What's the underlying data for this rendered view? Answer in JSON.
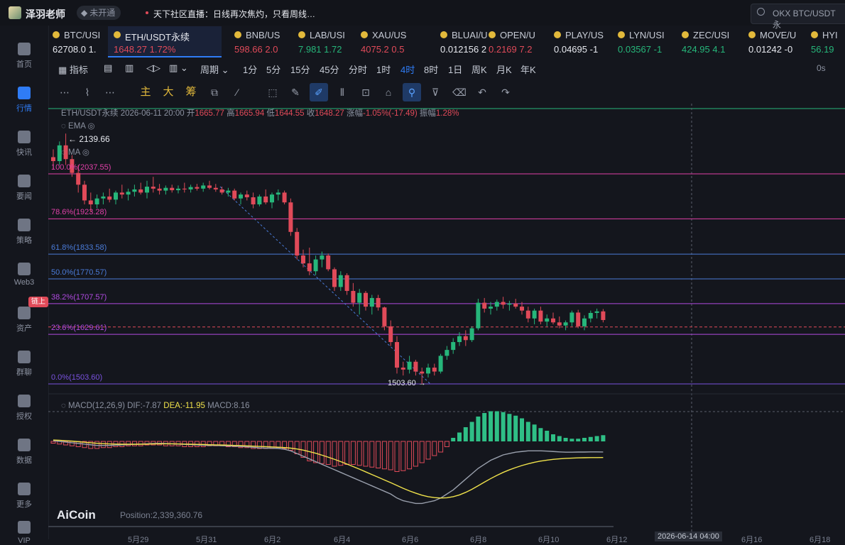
{
  "header": {
    "username": "泽羽老师",
    "vip_label": "未开通",
    "live_text": "天下社区直播：日线再次焦灼，只看周线…",
    "search_text": "OKX BTC/USDT 永"
  },
  "sidebar": {
    "items": [
      {
        "label": "首页",
        "icon": "home-icon"
      },
      {
        "label": "行情",
        "icon": "market-icon",
        "active": true
      },
      {
        "label": "快讯",
        "icon": "news-icon"
      },
      {
        "label": "要闻",
        "icon": "headline-icon"
      },
      {
        "label": "策略",
        "icon": "strategy-icon"
      },
      {
        "label": "Web3",
        "icon": "web3-icon"
      },
      {
        "label": "资产",
        "icon": "wallet-icon"
      },
      {
        "label": "群聊",
        "icon": "chat-icon"
      },
      {
        "label": "授权",
        "icon": "key-icon"
      },
      {
        "label": "数据",
        "icon": "data-icon"
      },
      {
        "label": "更多",
        "icon": "more-icon"
      },
      {
        "label": "VIP",
        "icon": "vip-icon"
      }
    ],
    "chain_badge": "链上"
  },
  "tickers": [
    {
      "name": "BTC/USI",
      "price": "62708.0",
      "change": "1.",
      "dir": "neutral"
    },
    {
      "name": "ETH/USDT永续",
      "price": "1648.27",
      "change": "1.72%",
      "dir": "down",
      "active": true
    },
    {
      "name": "BNB/US",
      "price": "598.66",
      "change": "2.0",
      "dir": "down"
    },
    {
      "name": "LAB/USI",
      "price": "7.981",
      "change": "1.72",
      "dir": "up"
    },
    {
      "name": "XAU/US",
      "price": "4075.2",
      "change": "0.5",
      "dir": "down"
    },
    {
      "name": "BLUAI/U",
      "price": "0.012156",
      "change": "2",
      "dir": "neutral"
    },
    {
      "name": "OPEN/U",
      "price": "0.2169",
      "change": "7.2",
      "dir": "down"
    },
    {
      "name": "PLAY/US",
      "price": "0.04695",
      "change": "-1",
      "dir": "neutral"
    },
    {
      "name": "LYN/USI",
      "price": "0.03567",
      "change": "-1",
      "dir": "up"
    },
    {
      "name": "ZEC/USI",
      "price": "424.95",
      "change": "4.1",
      "dir": "up"
    },
    {
      "name": "MOVE/U",
      "price": "0.01242",
      "change": "-0",
      "dir": "neutral"
    },
    {
      "name": "HYI",
      "price": "56.19",
      "change": "",
      "dir": "up"
    }
  ],
  "periods": {
    "indicator_label": "指标",
    "cycle_label": "周期",
    "items": [
      "1分",
      "5分",
      "15分",
      "45分",
      "分时",
      "1时",
      "4时",
      "8时",
      "1日",
      "周K",
      "月K",
      "年K"
    ],
    "active": "4时",
    "right_label": "0s"
  },
  "tools": {
    "text_tools": [
      "主",
      "大",
      "筹"
    ]
  },
  "chart_info": {
    "symbol": "ETH/USDT永续",
    "datetime": "2026-06-11 20:00",
    "open_label": "开",
    "open": "1665.77",
    "high_label": "高",
    "high": "1665.94",
    "low_label": "低",
    "low": "1644.55",
    "close_label": "收",
    "close": "1648.27",
    "change_label": "涨幅",
    "change": "-1.05%(-17.49)",
    "amp_label": "振幅",
    "amp": "1.28%",
    "ema_label": "EMA",
    "ma_label": "MA",
    "high_marker": "2139.66",
    "low_marker": "1503.60"
  },
  "fib_levels": [
    {
      "label": "100.0%(2037.55)",
      "color": "#e040a8"
    },
    {
      "label": "78.6%(1923.28)",
      "color": "#e040a8"
    },
    {
      "label": "61.8%(1833.58)",
      "color": "#4a7bd8"
    },
    {
      "label": "50.0%(1770.57)",
      "color": "#4a7bd8"
    },
    {
      "label": "38.2%(1707.57)",
      "color": "#b04ae0"
    },
    {
      "label": "23.6%(1629.61)",
      "color": "#b04ae0"
    },
    {
      "label": "0.0%(1503.60)",
      "color": "#7a52e0"
    }
  ],
  "macd": {
    "label": "MACD(12,26,9)",
    "dif": "DIF:-7.87",
    "dea": "DEA:-11.95",
    "macd": "MACD:8.16"
  },
  "footer": {
    "logo": "AiCoin",
    "position": "Position:2,339,360.76",
    "dates": [
      "5月29",
      "5月31",
      "6月2",
      "6月4",
      "6月6",
      "6月8",
      "6月10",
      "6月12",
      "6月16",
      "6月18"
    ],
    "cursor_date": "2026-06-14 04:00"
  },
  "colors": {
    "up": "#26b67a",
    "down": "#e04a59",
    "accent": "#2f7cf6",
    "dea": "#f0e24b"
  },
  "chart_data": {
    "type": "candlestick",
    "note_symbol": "ETH/USDT永续",
    "candles": [
      [
        2080,
        2100,
        2050,
        2070
      ],
      [
        2070,
        2120,
        2060,
        2110
      ],
      [
        2110,
        2140,
        2060,
        2075
      ],
      [
        2075,
        2085,
        2030,
        2040
      ],
      [
        2040,
        2060,
        1990,
        2010
      ],
      [
        2010,
        2020,
        1960,
        1970
      ],
      [
        1970,
        1990,
        1940,
        1960
      ],
      [
        1960,
        1985,
        1950,
        1975
      ],
      [
        1975,
        1990,
        1960,
        1980
      ],
      [
        1980,
        2000,
        1965,
        1972
      ],
      [
        1972,
        1995,
        1960,
        1990
      ],
      [
        1990,
        2010,
        1975,
        1985
      ],
      [
        1985,
        2000,
        1970,
        1992
      ],
      [
        1992,
        2010,
        1980,
        1998
      ],
      [
        1998,
        2015,
        1985,
        1990
      ],
      [
        1990,
        2020,
        1975,
        2005
      ],
      [
        2005,
        2030,
        1990,
        2000
      ],
      [
        2000,
        2012,
        1985,
        1995
      ],
      [
        1995,
        2008,
        1985,
        2002
      ],
      [
        2002,
        2010,
        1990,
        1996
      ],
      [
        1996,
        2008,
        1988,
        2000
      ],
      [
        2000,
        2015,
        1990,
        1998
      ],
      [
        1998,
        2010,
        1990,
        2004
      ],
      [
        2004,
        2012,
        1995,
        2000
      ],
      [
        2000,
        2015,
        1992,
        2008
      ],
      [
        2008,
        2020,
        1998,
        2002
      ],
      [
        2002,
        2012,
        1992,
        1998
      ],
      [
        1998,
        2005,
        1985,
        1990
      ],
      [
        1990,
        2002,
        1980,
        1995
      ],
      [
        1995,
        2000,
        1970,
        1975
      ],
      [
        1975,
        1990,
        1960,
        1985
      ],
      [
        1985,
        1995,
        1970,
        1978
      ],
      [
        1978,
        1990,
        1950,
        1960
      ],
      [
        1960,
        1985,
        1955,
        1980
      ],
      [
        1980,
        1998,
        1960,
        1965
      ],
      [
        1965,
        1990,
        1950,
        1985
      ],
      [
        1985,
        1998,
        1970,
        1990
      ],
      [
        1990,
        1995,
        1960,
        1965
      ],
      [
        1965,
        1975,
        1880,
        1890
      ],
      [
        1890,
        1900,
        1820,
        1830
      ],
      [
        1830,
        1845,
        1800,
        1810
      ],
      [
        1810,
        1850,
        1780,
        1790
      ],
      [
        1790,
        1830,
        1780,
        1820
      ],
      [
        1820,
        1840,
        1800,
        1830
      ],
      [
        1830,
        1835,
        1790,
        1795
      ],
      [
        1795,
        1800,
        1740,
        1750
      ],
      [
        1750,
        1790,
        1740,
        1780
      ],
      [
        1780,
        1785,
        1730,
        1740
      ],
      [
        1740,
        1760,
        1700,
        1710
      ],
      [
        1710,
        1745,
        1680,
        1735
      ],
      [
        1735,
        1740,
        1690,
        1700
      ],
      [
        1700,
        1730,
        1680,
        1722
      ],
      [
        1722,
        1730,
        1690,
        1698
      ],
      [
        1698,
        1700,
        1640,
        1650
      ],
      [
        1650,
        1665,
        1600,
        1610
      ],
      [
        1610,
        1625,
        1530,
        1545
      ],
      [
        1545,
        1560,
        1525,
        1540
      ],
      [
        1540,
        1575,
        1530,
        1560
      ],
      [
        1560,
        1565,
        1525,
        1535
      ],
      [
        1535,
        1545,
        1503,
        1530
      ],
      [
        1530,
        1555,
        1520,
        1545
      ],
      [
        1545,
        1555,
        1525,
        1535
      ],
      [
        1535,
        1580,
        1530,
        1575
      ],
      [
        1575,
        1600,
        1565,
        1590
      ],
      [
        1590,
        1620,
        1580,
        1610
      ],
      [
        1610,
        1635,
        1600,
        1625
      ],
      [
        1625,
        1640,
        1600,
        1615
      ],
      [
        1615,
        1650,
        1610,
        1645
      ],
      [
        1645,
        1720,
        1640,
        1710
      ],
      [
        1710,
        1722,
        1685,
        1695
      ],
      [
        1695,
        1712,
        1680,
        1700
      ],
      [
        1700,
        1718,
        1690,
        1712
      ],
      [
        1712,
        1725,
        1695,
        1705
      ],
      [
        1705,
        1715,
        1690,
        1708
      ],
      [
        1708,
        1720,
        1695,
        1700
      ],
      [
        1700,
        1712,
        1680,
        1690
      ],
      [
        1690,
        1700,
        1660,
        1670
      ],
      [
        1670,
        1695,
        1655,
        1690
      ],
      [
        1690,
        1700,
        1655,
        1662
      ],
      [
        1662,
        1680,
        1650,
        1670
      ],
      [
        1670,
        1685,
        1655,
        1660
      ],
      [
        1660,
        1675,
        1645,
        1652
      ],
      [
        1652,
        1665,
        1640,
        1660
      ],
      [
        1660,
        1690,
        1650,
        1685
      ],
      [
        1685,
        1692,
        1645,
        1650
      ],
      [
        1650,
        1678,
        1640,
        1670
      ],
      [
        1670,
        1690,
        1660,
        1684
      ],
      [
        1684,
        1695,
        1670,
        1688
      ],
      [
        1688,
        1694,
        1660,
        1666
      ]
    ],
    "macd_hist": [
      -2,
      -3,
      -4,
      -5,
      -6,
      -7,
      -8,
      -8,
      -7,
      -7,
      -6,
      -6,
      -5,
      -5,
      -5,
      -4,
      -4,
      -4,
      -5,
      -5,
      -5,
      -6,
      -6,
      -6,
      -6,
      -5,
      -5,
      -5,
      -6,
      -6,
      -7,
      -7,
      -8,
      -8,
      -8,
      -8,
      -7,
      -8,
      -10,
      -14,
      -18,
      -22,
      -24,
      -25,
      -26,
      -28,
      -27,
      -26,
      -26,
      -27,
      -28,
      -29,
      -30,
      -31,
      -32,
      -34,
      -33,
      -31,
      -28,
      -24,
      -20,
      -16,
      -12,
      -6,
      4,
      10,
      16,
      22,
      28,
      32,
      34,
      34,
      33,
      31,
      29,
      26,
      22,
      19,
      15,
      12,
      8,
      6,
      4,
      3,
      3,
      4,
      5,
      6,
      7
    ],
    "dif": [
      0.5,
      0,
      -0.5,
      -1,
      -1.5,
      -2,
      -2.5,
      -3,
      -3,
      -3,
      -2.8,
      -2.6,
      -2.4,
      -2.2,
      -2,
      -1.8,
      -1.6,
      -1.5,
      -1.6,
      -1.8,
      -2,
      -2.2,
      -2.4,
      -2.6,
      -2.8,
      -3,
      -3,
      -3.2,
      -3.4,
      -3.6,
      -3.8,
      -4,
      -4.4,
      -4.8,
      -5,
      -5,
      -5.2,
      -5.8,
      -7,
      -9,
      -11,
      -13,
      -15,
      -17,
      -19,
      -21,
      -23,
      -25,
      -27,
      -29,
      -31,
      -33,
      -35,
      -37,
      -39,
      -42,
      -44,
      -45,
      -46,
      -46,
      -45,
      -44,
      -42,
      -39,
      -36,
      -32,
      -28,
      -24,
      -20,
      -17,
      -14,
      -12,
      -10,
      -9,
      -8,
      -7.5,
      -7,
      -7,
      -7,
      -7.2,
      -7.5,
      -7.8,
      -8,
      -8,
      -7.9,
      -7.9,
      -7.8,
      -7.8,
      -7.87
    ],
    "dea": [
      1,
      0.8,
      0.5,
      0.2,
      -0.2,
      -0.6,
      -1,
      -1.4,
      -1.7,
      -1.9,
      -2,
      -2.1,
      -2.1,
      -2.1,
      -2.1,
      -2,
      -1.9,
      -1.8,
      -1.8,
      -1.8,
      -1.9,
      -2,
      -2.1,
      -2.2,
      -2.3,
      -2.5,
      -2.6,
      -2.7,
      -2.8,
      -3,
      -3.1,
      -3.3,
      -3.5,
      -3.7,
      -3.9,
      -4.1,
      -4.3,
      -4.6,
      -5,
      -5.6,
      -6.5,
      -7.6,
      -8.8,
      -10.2,
      -11.7,
      -13.3,
      -15,
      -16.8,
      -18.7,
      -20.6,
      -22.6,
      -24.6,
      -26.6,
      -28.6,
      -30.6,
      -32.7,
      -34.8,
      -36.7,
      -38.4,
      -39.9,
      -41,
      -41.7,
      -42,
      -41.8,
      -41,
      -39.7,
      -37.8,
      -35.5,
      -32.9,
      -30.2,
      -27.6,
      -25.2,
      -23,
      -21.1,
      -19.4,
      -17.9,
      -16.6,
      -15.5,
      -14.6,
      -13.9,
      -13.3,
      -12.9,
      -12.6,
      -12.4,
      -12.2,
      -12.1,
      -12,
      -12,
      -11.95
    ]
  }
}
